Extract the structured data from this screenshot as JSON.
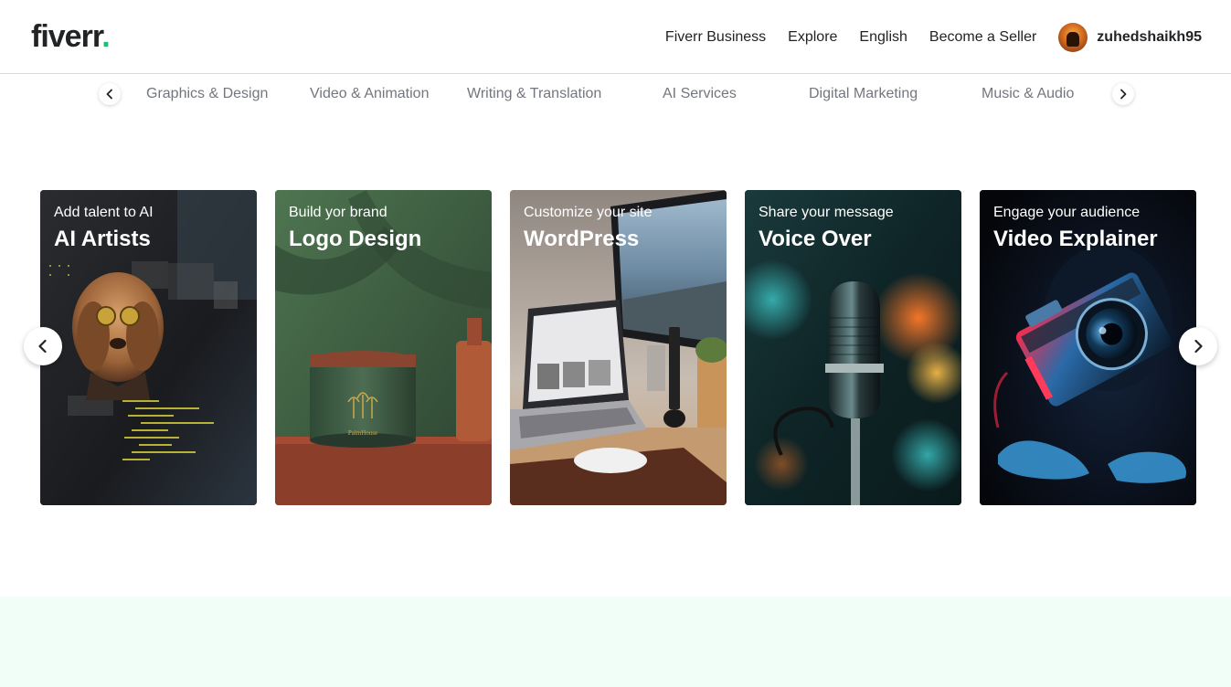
{
  "header": {
    "logo_text": "fiverr",
    "logo_dot": ".",
    "nav": [
      {
        "label": "Fiverr Business"
      },
      {
        "label": "Explore"
      },
      {
        "label": "English"
      },
      {
        "label": "Become a Seller"
      }
    ],
    "username": "zuhedshaikh95"
  },
  "categories": {
    "items": [
      {
        "label": "Graphics & Design"
      },
      {
        "label": "Video & Animation"
      },
      {
        "label": "Writing & Translation"
      },
      {
        "label": "AI Services"
      },
      {
        "label": "Digital Marketing"
      },
      {
        "label": "Music & Audio"
      }
    ],
    "prev_icon": "chevron-left-icon",
    "next_icon": "chevron-right-icon"
  },
  "carousel": {
    "cards": [
      {
        "subtitle": "Add talent to AI",
        "title": "AI Artists"
      },
      {
        "subtitle": "Build yor brand",
        "title": "Logo Design"
      },
      {
        "subtitle": "Customize your site",
        "title": "WordPress"
      },
      {
        "subtitle": "Share your message",
        "title": "Voice Over"
      },
      {
        "subtitle": "Engage your audience",
        "title": "Video Explainer"
      }
    ],
    "prev_icon": "chevron-left-icon",
    "next_icon": "chevron-right-icon"
  },
  "colors": {
    "brand_green": "#1dbf73",
    "text_dark": "#222325",
    "text_muted": "#74767e",
    "band_bg": "#f1fdf7"
  }
}
